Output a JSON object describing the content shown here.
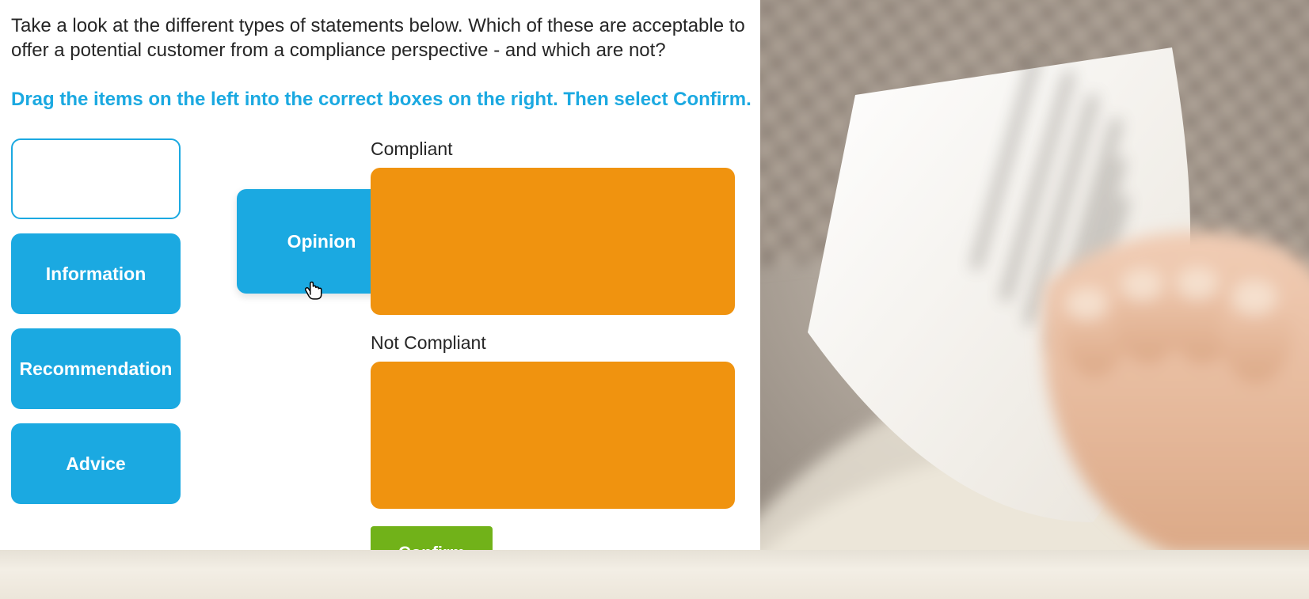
{
  "question": "Take a look at the different types of statements below. Which of these are acceptable to offer a potential customer from a compliance perspective - and which are not?",
  "instruction": "Drag the items on the left into the correct boxes on the right. Then select Confirm.",
  "source_items": {
    "dragging": "Opinion",
    "remaining": [
      "Information",
      "Recommendation",
      "Advice"
    ]
  },
  "targets": {
    "compliant_label": "Compliant",
    "not_compliant_label": "Not Compliant"
  },
  "buttons": {
    "confirm": "Confirm"
  },
  "colors": {
    "accent_blue": "#1ba9e1",
    "drop_orange": "#f0930f",
    "confirm_green": "#71b219"
  }
}
